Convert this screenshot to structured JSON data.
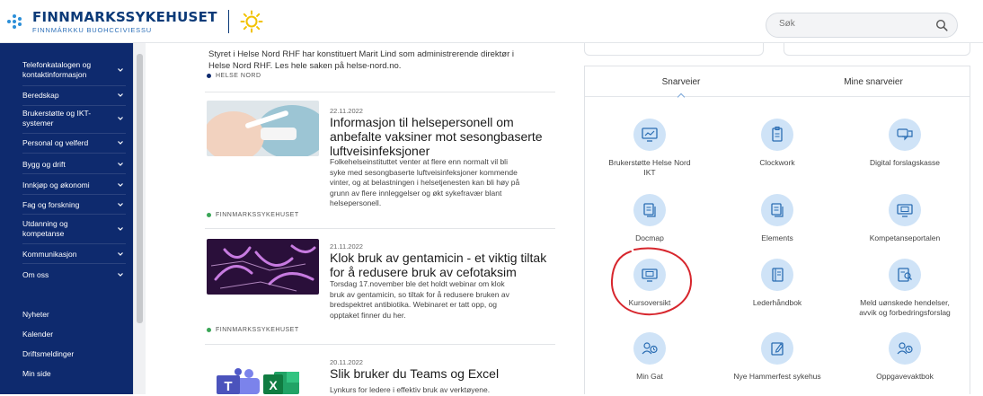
{
  "header": {
    "logo_main": "FINNMARKSSYKEHUSET",
    "logo_sub": "FINNMÁRKKU BUOHCCIVIESSU",
    "search_placeholder": "Søk",
    "colors": {
      "brand_dark": "#0b3a78",
      "brand_light": "#2c8fd8",
      "sun": "#f2c200"
    }
  },
  "sidebar": {
    "background": "#0e2a6e",
    "items": [
      {
        "label_lines": [
          "Telefonkatalogen og",
          "kontaktinformasjon"
        ]
      },
      {
        "label_lines": [
          "Beredskap"
        ]
      },
      {
        "label_lines": [
          "Brukerstøtte og IKT-",
          "systemer"
        ]
      },
      {
        "label_lines": [
          "Personal og velferd"
        ]
      },
      {
        "label_lines": [
          "Bygg og drift"
        ]
      },
      {
        "label_lines": [
          "Innkjøp og økonomi"
        ]
      },
      {
        "label_lines": [
          "Fag og forskning"
        ]
      },
      {
        "label_lines": [
          "Utdanning og",
          "kompetanse"
        ]
      },
      {
        "label_lines": [
          "Kommunikasjon"
        ]
      },
      {
        "label_lines": [
          "Om oss"
        ]
      }
    ],
    "bottom_links": [
      "Nyheter",
      "Kalender",
      "Driftsmeldinger",
      "Min side"
    ]
  },
  "news": {
    "intro_lines": [
      "Styret i Helse Nord RHF har konstituert Marit Lind som administrerende direktør i",
      "Helse Nord RHF. Les hele saken på helse-nord.no."
    ],
    "intro_source": "HELSE NORD",
    "articles": [
      {
        "date": "22.11.2022",
        "title_lines": [
          "Informasjon til helsepersonell om",
          "anbefalte vaksiner mot sesongbaserte",
          "luftveisinfeksjoner"
        ],
        "body_lines": [
          "Folkehelseinstituttet venter at flere enn normalt vil bli",
          "syke med sesongbaserte luftveisinfeksjoner kommende",
          "vinter, og at belastningen i helsetjenesten kan bli høy på",
          "grunn av flere innleggelser og økt sykefravær blant",
          "helsepersonell."
        ],
        "source": "FINNMARKSSYKEHUSET"
      },
      {
        "date": "21.11.2022",
        "title_lines": [
          "Klok bruk av gentamicin - et viktig tiltak",
          "for å redusere bruk av cefotaksim"
        ],
        "body_lines": [
          "Torsdag 17.november ble det holdt webinar om klok",
          "bruk av gentamicin, so tiltak for å redusere bruken av",
          "bredspektret antibiotika. Webinaret er tatt opp, og",
          "opptaket finner du her."
        ],
        "source": "FINNMARKSSYKEHUSET"
      },
      {
        "date": "20.11.2022",
        "title_lines": [
          "Slik bruker du Teams og Excel"
        ],
        "body_lines": [
          "Lynkurs for ledere i effektiv bruk av verktøyene."
        ],
        "source": ""
      }
    ],
    "thumb_icons": {
      "teams_letter": "T",
      "excel_letter": "X"
    }
  },
  "snarveier": {
    "tabs": [
      "Snarveier",
      "Mine snarveier"
    ],
    "active_tab": 0,
    "shortcuts": [
      {
        "label_lines": [
          "Brukerstøtte Helse Nord",
          "IKT"
        ],
        "icon": "support-monitor-icon"
      },
      {
        "label_lines": [
          "Clockwork"
        ],
        "icon": "document-clip-icon"
      },
      {
        "label_lines": [
          "Digital forslagskasse"
        ],
        "icon": "chat-bubbles-icon"
      },
      {
        "label_lines": [
          "Docmap"
        ],
        "icon": "document-stack-icon"
      },
      {
        "label_lines": [
          "Elements"
        ],
        "icon": "document-stack-icon"
      },
      {
        "label_lines": [
          "Kompetanseportalen"
        ],
        "icon": "monitor-icon"
      },
      {
        "label_lines": [
          "Kursoversikt"
        ],
        "icon": "monitor-icon"
      },
      {
        "label_lines": [
          "Lederhåndbok"
        ],
        "icon": "handbook-icon"
      },
      {
        "label_lines": [
          "Meld uønskede hendelser,",
          "avvik og forbedringsforslag"
        ],
        "icon": "report-icon"
      },
      {
        "label_lines": [
          "Min Gat"
        ],
        "icon": "person-clock-icon"
      },
      {
        "label_lines": [
          "Nye Hammerfest sykehus"
        ],
        "icon": "edit-doc-icon"
      },
      {
        "label_lines": [
          "Oppgavevaktbok"
        ],
        "icon": "person-clock-icon"
      }
    ],
    "colors": {
      "icon_circle": "#cfe3f7",
      "icon_stroke": "#2a6db3",
      "annotation": "#d7262d"
    }
  }
}
